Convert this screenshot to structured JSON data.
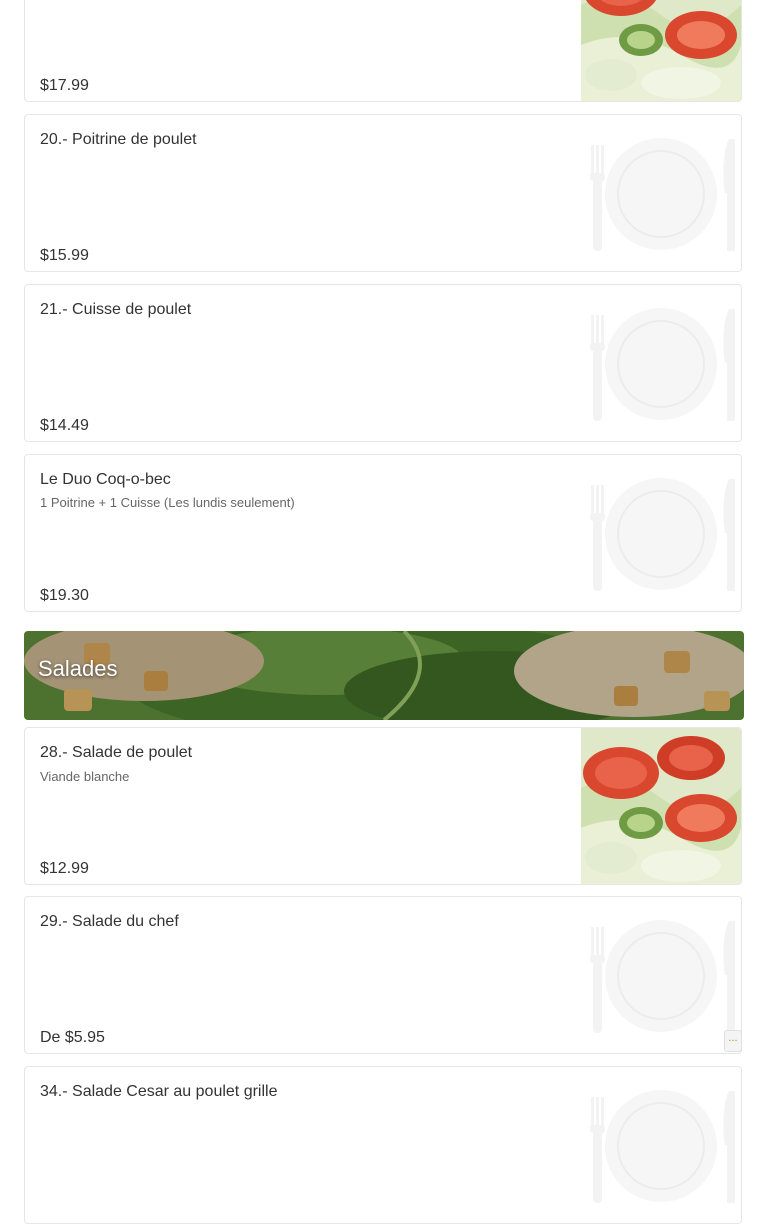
{
  "items_top": [
    {
      "price": "$17.99",
      "image": "salad-photo"
    },
    {
      "title": "20.- Poitrine de poulet",
      "price": "$15.99",
      "image": "plate-placeholder-icon"
    },
    {
      "title": "21.- Cuisse de poulet",
      "price": "$14.49",
      "image": "plate-placeholder-icon"
    },
    {
      "title": "Le Duo Coq-o-bec",
      "description": "1 Poitrine + 1 Cuisse (Les lundis seulement)",
      "price": "$19.30",
      "image": "plate-placeholder-icon"
    }
  ],
  "section": {
    "title": "Salades",
    "image": "salad-banner-photo"
  },
  "salads": [
    {
      "title": "28.- Salade de poulet",
      "description": "Viande blanche",
      "price": "$12.99",
      "image": "salad-photo"
    },
    {
      "title": "29.- Salade du chef",
      "price": "De $5.95",
      "image": "plate-placeholder-icon"
    },
    {
      "title": "34.- Salade Cesar au poulet grille",
      "image": "plate-placeholder-icon"
    }
  ],
  "more_button": {
    "label": "..."
  },
  "colors": {
    "placeholder": "#f7f7f7",
    "border": "#e6e6e6",
    "text": "#333333"
  }
}
